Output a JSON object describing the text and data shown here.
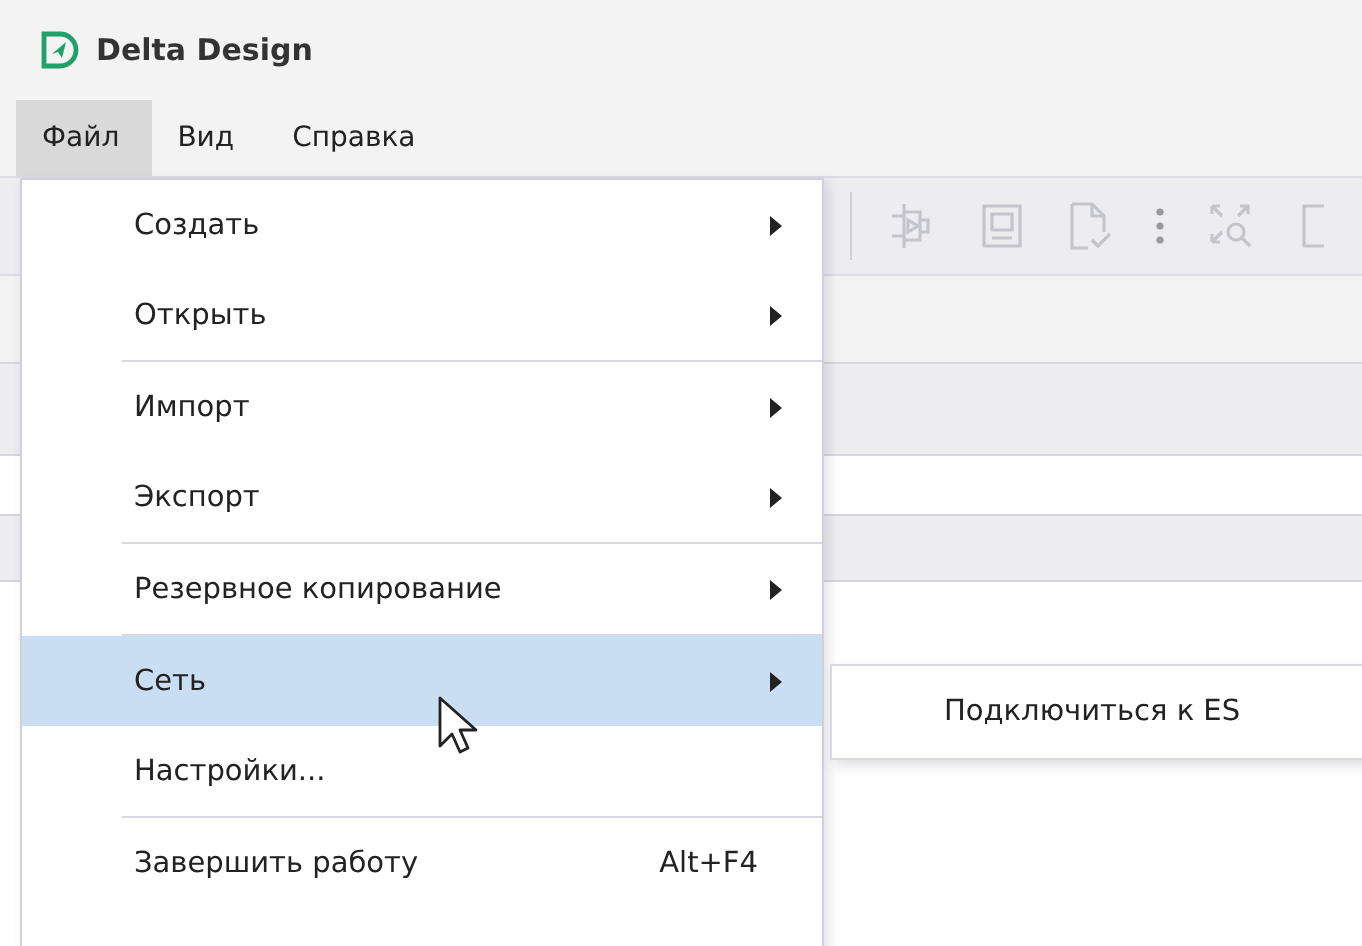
{
  "window": {
    "title": "Delta Design"
  },
  "menu_bar": [
    {
      "label": "Файл",
      "selected": true
    },
    {
      "label": "Вид",
      "selected": false
    },
    {
      "label": "Справка",
      "selected": false
    }
  ],
  "file_menu": {
    "items": [
      {
        "kind": "item",
        "label": "Создать",
        "submenu": true,
        "selected": false
      },
      {
        "kind": "item",
        "label": "Открыть",
        "submenu": true,
        "selected": false
      },
      {
        "kind": "separator"
      },
      {
        "kind": "item",
        "label": "Импорт",
        "submenu": true,
        "selected": false
      },
      {
        "kind": "item",
        "label": "Экспорт",
        "submenu": true,
        "selected": false
      },
      {
        "kind": "separator"
      },
      {
        "kind": "item",
        "label": "Резервное копирование",
        "submenu": true,
        "selected": false
      },
      {
        "kind": "separator"
      },
      {
        "kind": "item",
        "label": "Сеть",
        "submenu": true,
        "selected": true
      },
      {
        "kind": "item",
        "label": "Настройки...",
        "submenu": false,
        "selected": false
      },
      {
        "kind": "separator"
      },
      {
        "kind": "item",
        "label": "Завершить работу",
        "submenu": false,
        "shortcut": "Alt+F4",
        "selected": false
      }
    ]
  },
  "submenu": {
    "items": [
      {
        "label": "Подключиться к ES"
      }
    ]
  }
}
